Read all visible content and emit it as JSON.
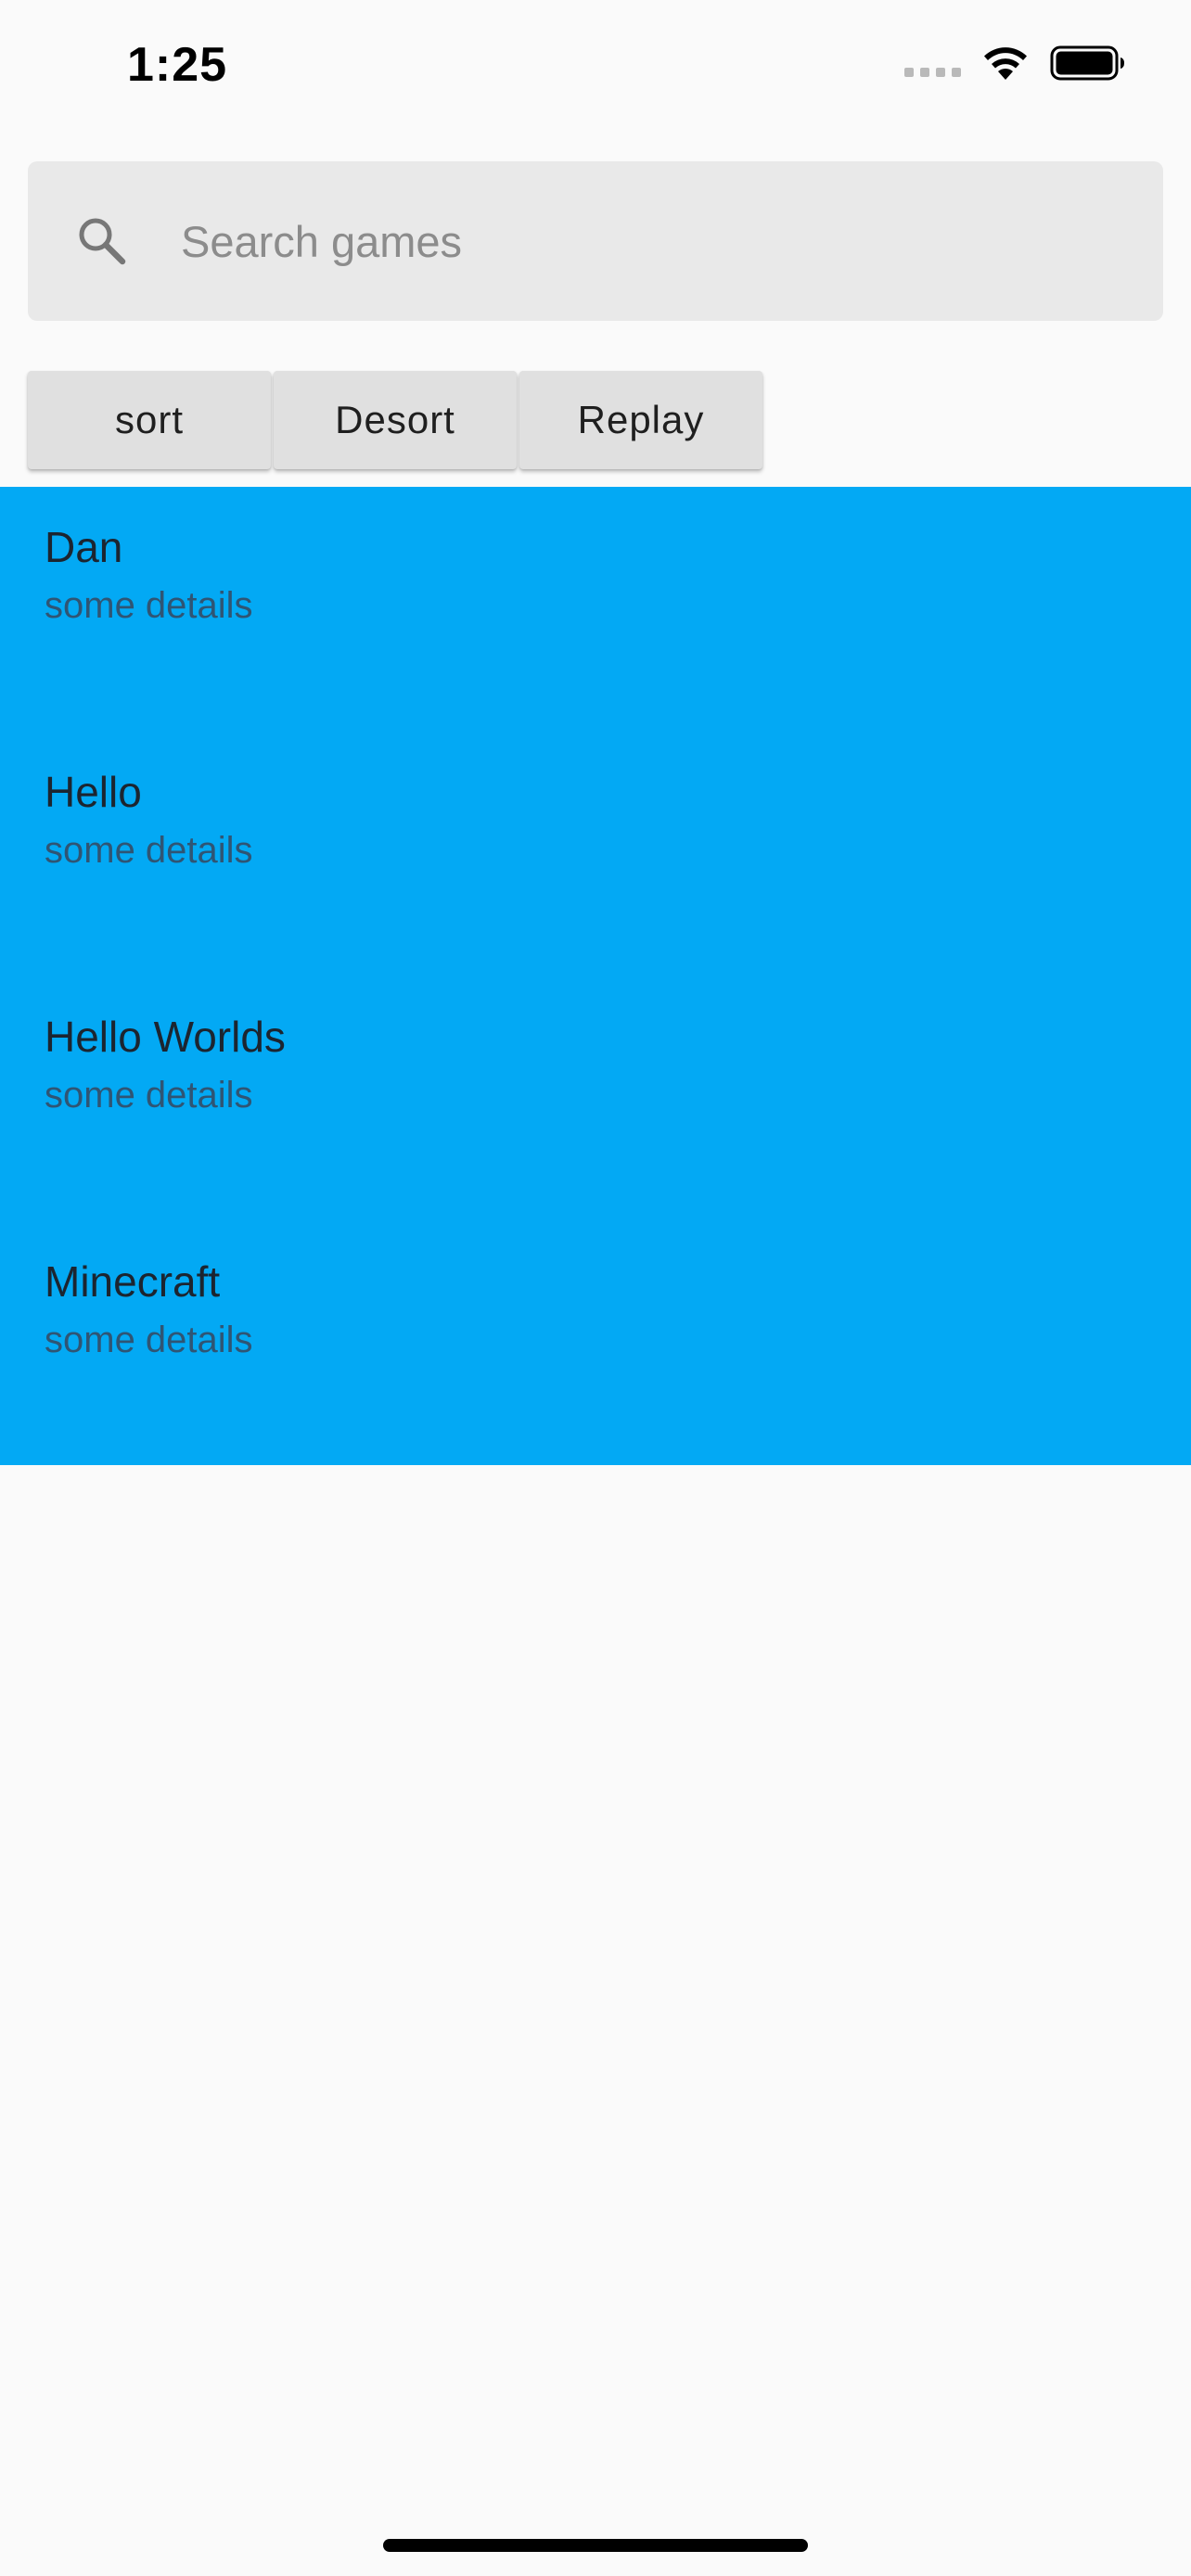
{
  "status_bar": {
    "time": "1:25",
    "icons": [
      "cellular-signal-icon",
      "wifi-icon",
      "battery-icon"
    ]
  },
  "search": {
    "placeholder": "Search games",
    "value": "",
    "icon": "search-icon"
  },
  "buttons": [
    {
      "label": "sort"
    },
    {
      "label": "Desort"
    },
    {
      "label": "Replay"
    }
  ],
  "games": [
    {
      "title": "Dan",
      "subtitle": "some details"
    },
    {
      "title": "Hello",
      "subtitle": "some details"
    },
    {
      "title": "Hello Worlds",
      "subtitle": "some details"
    },
    {
      "title": "Minecraft",
      "subtitle": "some details"
    }
  ],
  "colors": {
    "list_background": "#03a9f4",
    "page_background": "#fafafa",
    "search_background": "#e9e9e9",
    "button_background": "#e0e0e0"
  }
}
